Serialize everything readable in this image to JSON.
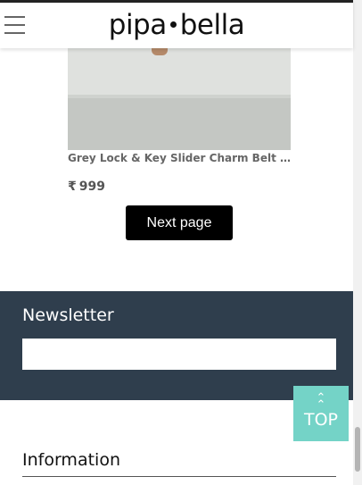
{
  "header": {
    "menu_icon": "hamburger-menu-icon",
    "logo_left": "pipa",
    "logo_right": "bella"
  },
  "product": {
    "name": "Grey Lock & Key Slider Charm Belt Br...",
    "currency": "₹",
    "price": "999"
  },
  "pagination": {
    "next_label": "Next page"
  },
  "newsletter": {
    "title": "Newsletter",
    "input_value": ""
  },
  "scroll_top": {
    "icon": "double-chevron-up-icon",
    "label": "TOP"
  },
  "footer": {
    "info_title": "Information"
  },
  "colors": {
    "newsletter_bg": "#2f3e4d",
    "top_button_bg": "#74d3c7",
    "button_bg": "#000000"
  }
}
